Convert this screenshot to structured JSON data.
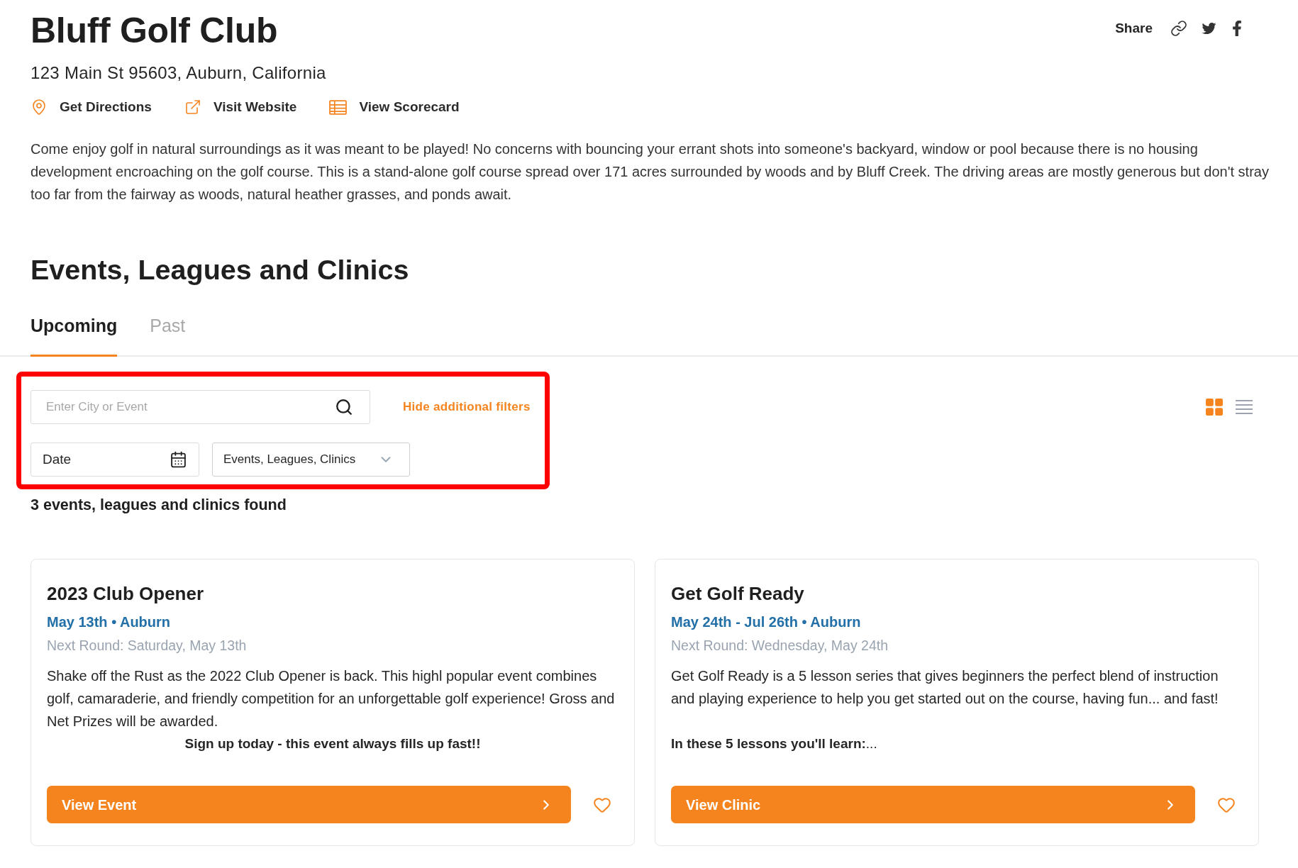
{
  "club": {
    "name": "Bluff Golf Club",
    "address": "123 Main St 95603, Auburn, California"
  },
  "share": {
    "label": "Share"
  },
  "actions": [
    {
      "label": "Get Directions"
    },
    {
      "label": "Visit Website"
    },
    {
      "label": "View Scorecard"
    }
  ],
  "description": "Come enjoy golf in natural surroundings as it was meant to be played! No concerns with bouncing your errant shots into someone's backyard, window or pool because there is no housing development encroaching on the golf course. This is a stand-alone golf course spread over 171 acres surrounded by woods and by Bluff Creek. The driving areas are mostly generous but don't stray too far from the fairway as woods, natural heather grasses, and ponds await.",
  "section": {
    "title": "Events, Leagues and Clinics",
    "tabs": [
      {
        "label": "Upcoming",
        "selected": true
      },
      {
        "label": "Past",
        "selected": false
      }
    ]
  },
  "filters": {
    "highlighted": true,
    "search": {
      "placeholder": "Enter City or Event"
    },
    "toggle_link": "Hide additional filters",
    "date_field": {
      "value": "Date"
    },
    "category_select": {
      "value": "Events, Leagues, Clinics"
    }
  },
  "view_modes": [
    {
      "selected": true
    },
    {
      "selected": false
    }
  ],
  "results_count": "3 events, leagues and clinics found",
  "cards": [
    {
      "title": "2023 Club Opener",
      "when": "May 13th • Auburn",
      "next_round": "Next Round: Saturday, May 13th",
      "paragraphs": [
        {
          "kind": "body",
          "text": "Shake off the Rust as the 2022 Club Opener is back. This highl popular event combines golf, camaraderie, and friendly competition for an unforgettable golf experience! Gross and Net Prizes will be awarded."
        },
        {
          "kind": "callout",
          "text": "Sign up today - this event always fills up fast!!"
        }
      ],
      "button": "View Event",
      "favorited": false
    },
    {
      "title": "Get Golf Ready",
      "when": "May 24th - Jul 26th • Auburn",
      "next_round": "Next Round: Wednesday, May 24th",
      "paragraphs": [
        {
          "kind": "body",
          "text": "Get Golf Ready is a 5 lesson series that gives beginners the perfect blend of instruction and playing experience to help you get started out on the course, having fun... and fast!"
        },
        {
          "kind": "lead",
          "text": "**In these 5 lessons you'll learn:**..."
        }
      ],
      "button": "View Clinic",
      "favorited": false
    }
  ]
}
